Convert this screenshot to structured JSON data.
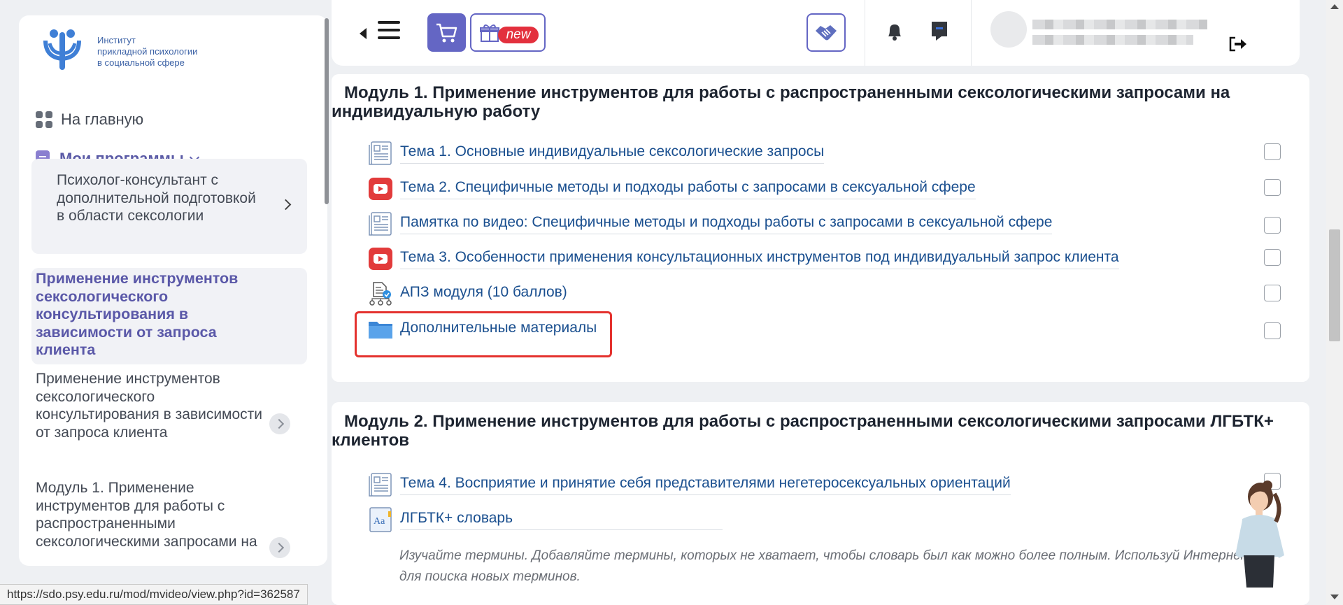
{
  "sidebar": {
    "logo_text_line1": "Институт",
    "logo_text_line2": "прикладной психологии",
    "logo_text_line3": "в социальной сфере",
    "home_label": "На главную",
    "programs_label": "Мои программы",
    "program_card": "Психолог-консультант с дополнительной подготовкой в области сексологии",
    "active_item": "Применение инструментов сексологического консультирования в зависимости от запроса клиента",
    "items": [
      {
        "label": "Применение инструментов сексологического консультирования в зависимости от запроса клиента"
      },
      {
        "label": "Модуль 1. Применение инструментов для работы с распространенными сексологическими запросами на"
      }
    ]
  },
  "topbar": {
    "new_badge": "new"
  },
  "modules": [
    {
      "title": "Модуль 1. Применение инструментов для работы с распространенными сексологическими запросами на индивидуальную работу",
      "activities": [
        {
          "label": "Тема 1. Основные индивидуальные сексологические запросы",
          "icon": "page-icon"
        },
        {
          "label": "Тема 2. Специфичные методы и подходы работы с запросами в сексуальной сфере",
          "icon": "video-icon"
        },
        {
          "label": "Памятка по видео: Специфичные методы и подходы работы с запросами в сексуальной сфере",
          "icon": "page-icon"
        },
        {
          "label": "Тема 3. Особенности применения консультационных инструментов под индивидуальный запрос клиента",
          "icon": "video-icon"
        },
        {
          "label": "АПЗ модуля (10 баллов)",
          "icon": "assignment-icon"
        },
        {
          "label": "Дополнительные материалы",
          "icon": "folder-icon"
        }
      ]
    },
    {
      "title": "Модуль 2. Применение инструментов для работы с распространенными сексологическими запросами ЛГБТК+ клиентов",
      "activities": [
        {
          "label": "Тема 4. Восприятие и принятие себя представителями негетеросексуальных ориентаций",
          "icon": "page-icon"
        },
        {
          "label": "ЛГБТК+ словарь",
          "icon": "glossary-icon"
        }
      ],
      "description": "Изучайте термины. Добавляйте термины, которых не хватает, чтобы словарь был как можно более полным. Используй Интернет для поиска новых терминов."
    }
  ],
  "statusbar": {
    "url": "https://sdo.psy.edu.ru/mod/mvideo/view.php?id=362587"
  },
  "colors": {
    "accent": "#6466c4",
    "link": "#1a4f8f",
    "highlight": "#e4322e",
    "sidebar_active": "#5a58a8"
  }
}
